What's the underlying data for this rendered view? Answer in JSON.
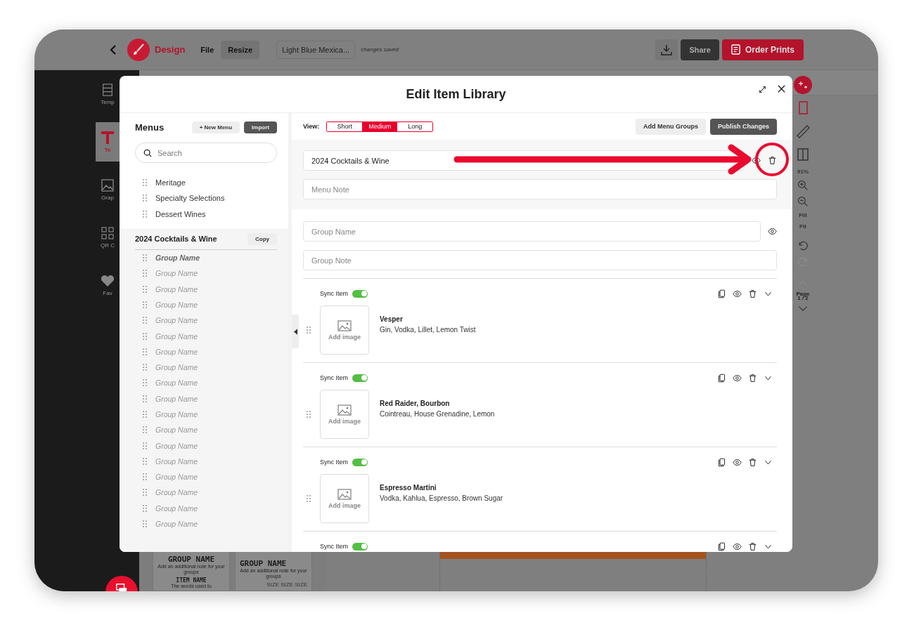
{
  "app_bar": {
    "brand": "Design",
    "menu": [
      {
        "label": "File",
        "kind": "link"
      },
      {
        "label": "Resize",
        "kind": "button"
      }
    ],
    "document_title": "Light Blue Mexica...",
    "save_status": "changes saved",
    "actions": [
      {
        "kind": "download"
      },
      {
        "kind": "share",
        "label": "Share"
      },
      {
        "kind": "order",
        "label": "Order Prints"
      }
    ]
  },
  "sidebar": {
    "items": [
      {
        "label": "Temp",
        "selected": false
      },
      {
        "label": "Te",
        "selected": true
      },
      {
        "label": "Grap",
        "selected": false
      },
      {
        "label": "QR C",
        "selected": false
      },
      {
        "label": "Fav",
        "selected": false
      }
    ]
  },
  "right_toolbar": {
    "zoom": "91%",
    "fill": "Fill",
    "fit": "Fit",
    "page_label": "Page",
    "page_number": "1 / 2"
  },
  "canvas_preview": {
    "cards": [
      {
        "group_name": "GROUP NAME",
        "group_note": "Add an additional note for your groups",
        "item_name": "ITEM NAME",
        "item_text": "The words used to"
      },
      {
        "group_name": "GROUP NAME",
        "group_note": "Add an additional note for your groups",
        "sizes": "SIZE SIZE SIZE"
      }
    ]
  },
  "modal": {
    "title": "Edit Item Library",
    "menus_panel": {
      "title": "Menus",
      "new_button": "+ New Menu",
      "import_button": "Import",
      "search": {
        "placeholder": "Search"
      },
      "menus": [
        "Meritage",
        "Specialty Selections",
        "Dessert Wines"
      ],
      "current_menu": {
        "name": "2024 Cocktails & Wine",
        "copy_button": "Copy",
        "groups": [
          {
            "label": "Group Name",
            "selected": true
          },
          {
            "label": "Group Name",
            "selected": false
          },
          {
            "label": "Group Name",
            "selected": false
          },
          {
            "label": "Group Name",
            "selected": false
          },
          {
            "label": "Group Name",
            "selected": false
          },
          {
            "label": "Group Name",
            "selected": false
          },
          {
            "label": "Group Name",
            "selected": false
          },
          {
            "label": "Group Name",
            "selected": false
          },
          {
            "label": "Group Name",
            "selected": false
          },
          {
            "label": "Group Name",
            "selected": false
          },
          {
            "label": "Group Name",
            "selected": false
          },
          {
            "label": "Group Name",
            "selected": false
          },
          {
            "label": "Group Name",
            "selected": false
          },
          {
            "label": "Group Name",
            "selected": false
          },
          {
            "label": "Group Name",
            "selected": false
          },
          {
            "label": "Group Name",
            "selected": false
          },
          {
            "label": "Group Name",
            "selected": false
          },
          {
            "label": "Group Name",
            "selected": false
          }
        ]
      }
    },
    "editor": {
      "view_label": "View:",
      "views": [
        {
          "label": "Short",
          "selected": false
        },
        {
          "label": "Medium",
          "selected": true
        },
        {
          "label": "Long",
          "selected": false
        }
      ],
      "add_groups_button": "Add Menu Groups",
      "publish_button": "Publish Changes",
      "menu_name": {
        "value": "2024 Cocktails & Wine"
      },
      "menu_note": {
        "placeholder": "Menu Note"
      },
      "group_name": {
        "placeholder": "Group Name"
      },
      "group_note": {
        "placeholder": "Group Note"
      },
      "items": [
        {
          "sync_label": "Sync Item",
          "sync": true,
          "image_label": "Add image",
          "name": "Vesper",
          "description": "Gin, Vodka, Lillet, Lemon Twist"
        },
        {
          "sync_label": "Sync Item",
          "sync": true,
          "image_label": "Add image",
          "name": "Red Raider, Bourbon",
          "description": "Cointreau, House Grenadine, Lemon"
        },
        {
          "sync_label": "Sync Item",
          "sync": true,
          "image_label": "Add image",
          "name": "Espresso Martini",
          "description": "Vodka, Kahlua, Espresso, Brown Sugar"
        },
        {
          "sync_label": "Sync Item",
          "sync": true
        }
      ]
    }
  }
}
